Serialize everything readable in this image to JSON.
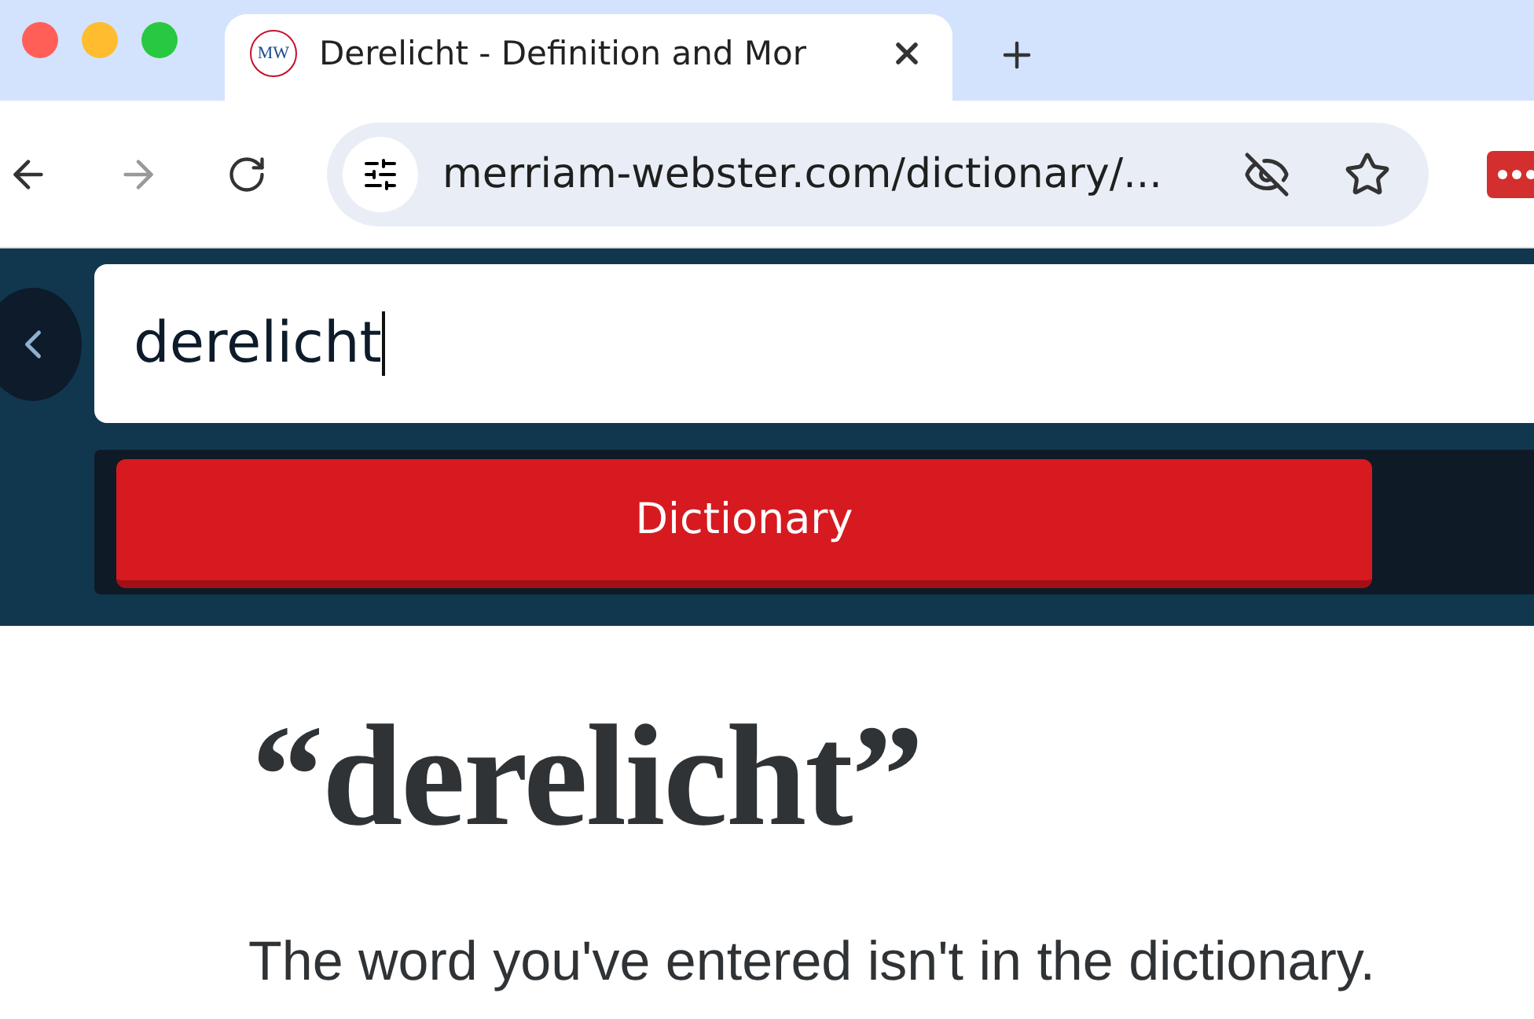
{
  "browser": {
    "tab": {
      "favicon_text": "MW",
      "title": "Derelicht - Definition and Mor",
      "selected": true
    },
    "address": "merriam-webster.com/dictionary/..."
  },
  "search": {
    "value": "derelicht"
  },
  "dictionary_tab": {
    "label": "Dictionary",
    "selected": true
  },
  "page": {
    "heading": "“derelicht”",
    "message": "The word you've entered isn't in the dictionary."
  }
}
